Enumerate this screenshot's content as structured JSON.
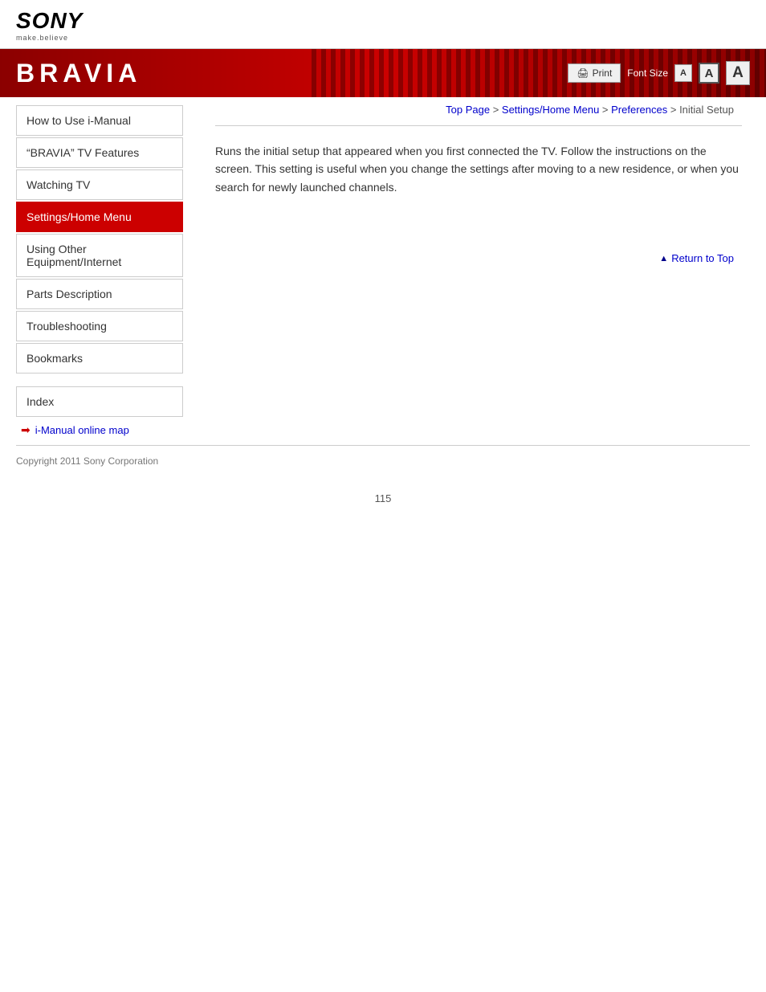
{
  "header": {
    "sony_text": "SONY",
    "sony_tagline": "make.believe"
  },
  "banner": {
    "title": "BRAVIA",
    "print_label": "Print",
    "font_size_label": "Font Size",
    "font_btn_sm": "A",
    "font_btn_md": "A",
    "font_btn_lg": "A"
  },
  "breadcrumb": {
    "top_page": "Top Page",
    "settings_home_menu": "Settings/Home Menu",
    "preferences": "Preferences",
    "current": "Initial Setup",
    "sep1": " > ",
    "sep2": " > ",
    "sep3": " > "
  },
  "sidebar": {
    "items": [
      {
        "label": "How to Use i-Manual",
        "active": false
      },
      {
        "label": "“BRAVIA” TV Features",
        "active": false
      },
      {
        "label": "Watching TV",
        "active": false
      },
      {
        "label": "Settings/Home Menu",
        "active": true
      },
      {
        "label": "Using Other Equipment/Internet",
        "active": false
      },
      {
        "label": "Parts Description",
        "active": false
      },
      {
        "label": "Troubleshooting",
        "active": false
      },
      {
        "label": "Bookmarks",
        "active": false
      }
    ],
    "index_label": "Index",
    "online_map_label": "i-Manual online map"
  },
  "content": {
    "body_text": "Runs the initial setup that appeared when you first connected the TV. Follow the instructions on the screen. This setting is useful when you change the settings after moving to a new residence, or when you search for newly launched channels."
  },
  "return_top": {
    "label": "Return to Top"
  },
  "footer": {
    "copyright": "Copyright 2011 Sony Corporation"
  },
  "page_number": "115"
}
